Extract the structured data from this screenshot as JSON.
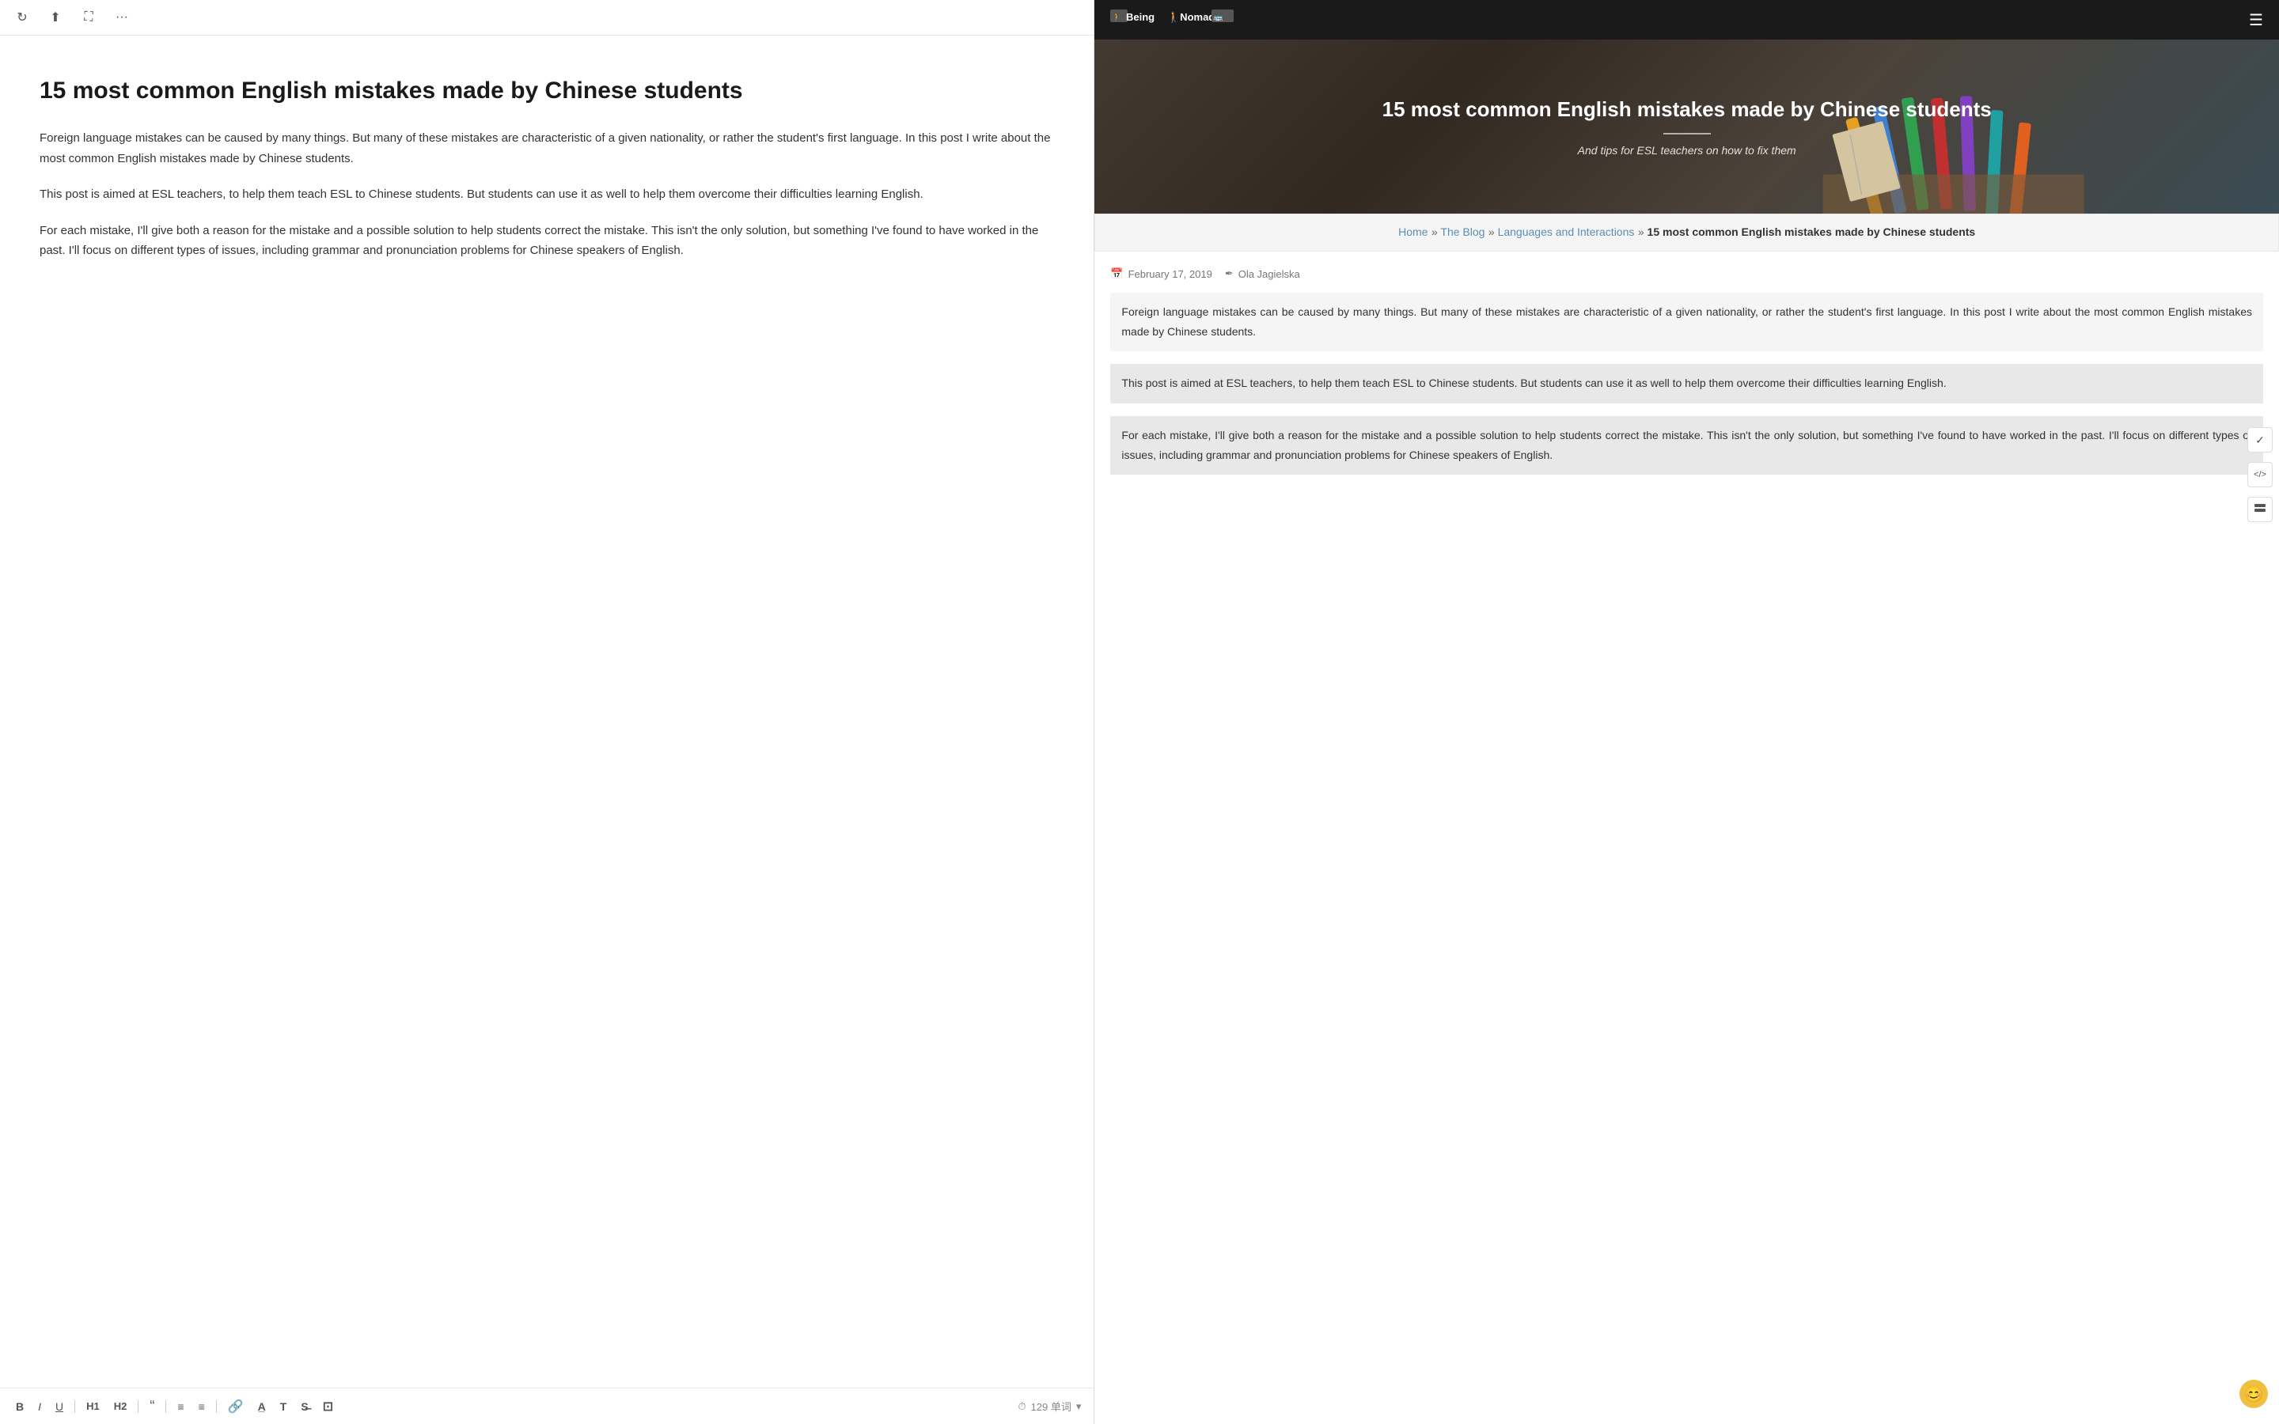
{
  "editor": {
    "toolbar_top": {
      "refresh_label": "↻",
      "share_label": "⬆",
      "expand_label": "⛶",
      "more_label": "···"
    },
    "title": "15 most common English mistakes made by Chinese students",
    "paragraphs": [
      "Foreign language mistakes can be caused by many things. But many of these mistakes are characteristic of a given nationality, or rather the student's first language. In this post I write about the most common English mistakes made by Chinese students.",
      "This post is aimed at ESL teachers, to help them teach ESL to Chinese students. But students can use it as well to help them overcome their difficulties learning English.",
      "For each mistake, I'll give both a reason for the mistake and a possible solution to help students correct the mistake. This isn't the only solution, but something I've found to have worked in the past. I'll focus on different types of issues, including grammar and pronunciation problems for Chinese speakers of English."
    ],
    "bottom_toolbar": {
      "bold": "B",
      "italic": "I",
      "underline": "U",
      "heading1": "H1",
      "heading2": "H2",
      "quote": "“",
      "list_ul": "≡",
      "list_ol": "≡",
      "link": "🔗",
      "underline2": "A̲",
      "type": "T",
      "strikethrough": "S̶",
      "image": "⊡",
      "clock_icon": "⏱",
      "word_count": "129 单词",
      "word_count_arrow": "▾"
    }
  },
  "website": {
    "nav": {
      "logo_text": "🚶Being🚶Nomad🚌",
      "menu_icon": "☰"
    },
    "hero": {
      "title": "15 most common English mistakes made by Chinese students",
      "subtitle": "And tips for ESL teachers on how to fix them"
    },
    "breadcrumb": {
      "home": "Home",
      "sep1": "»",
      "blog": "The Blog",
      "sep2": "»",
      "category": "Languages and Interactions",
      "sep3": "»",
      "current": "15 most common English mistakes made by Chinese students"
    },
    "article": {
      "date": "February 17, 2019",
      "author": "Ola Jagielska",
      "paragraphs": [
        "Foreign language mistakes can be caused by many things. But many of these mistakes are characteristic of a given nationality, or rather the student's first language. In this post I write about the most common English mistakes made by Chinese students.",
        "This post is aimed at ESL teachers, to help them teach ESL to Chinese students. But students can use it as well to help them overcome their difficulties learning English.",
        "For each mistake, I'll give both a reason for the mistake and a possible solution to help students correct the mistake. This isn't the only solution, but something I've found to have worked in the past. I'll focus on different types of issues, including grammar and pronunciation problems for Chinese speakers of English."
      ]
    }
  },
  "right_sidebar": {
    "check_icon": "✓",
    "code_icon": "</>"
  },
  "avatar_emoji": "😊"
}
